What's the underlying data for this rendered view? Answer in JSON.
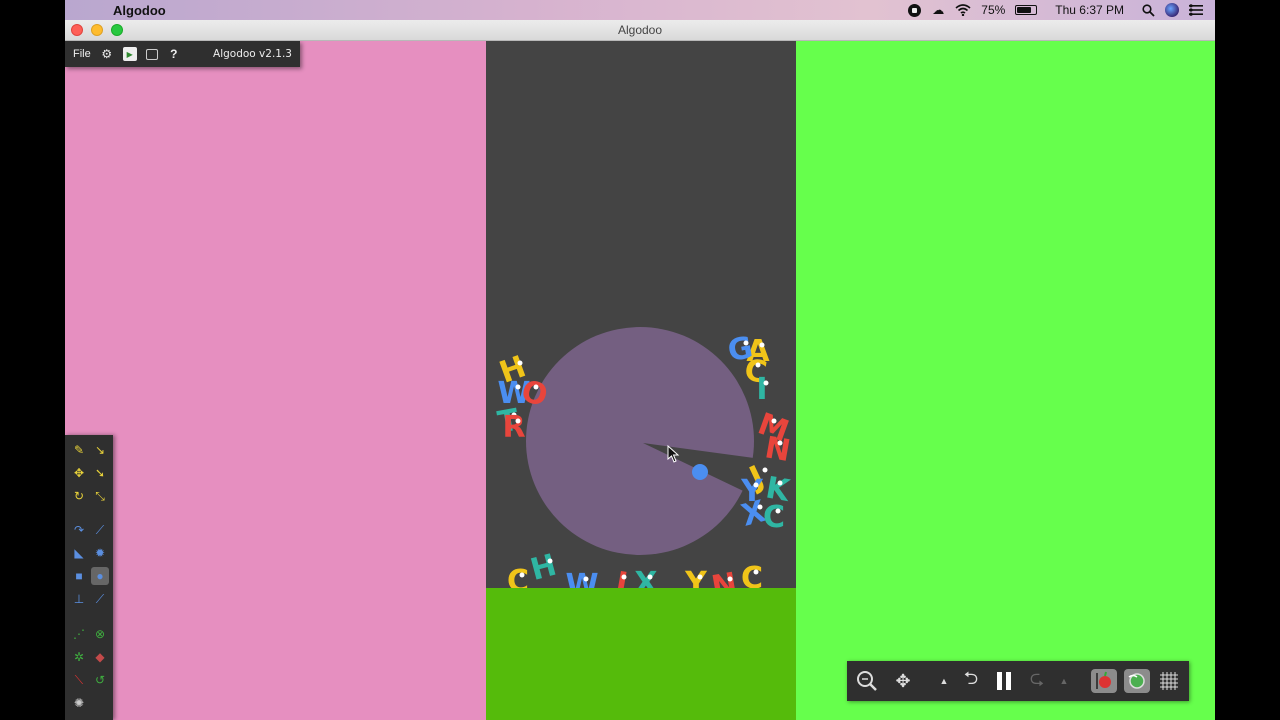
{
  "menubar": {
    "app_name": "Algodoo",
    "battery": "75%",
    "battery_level": 0.75,
    "clock": "Thu 6:37 PM"
  },
  "window": {
    "title": "Algodoo"
  },
  "topbar": {
    "file_label": "File",
    "version": "Algodoo v2.1.3"
  },
  "scene_colors": {
    "left_panel": "#e68fc0",
    "container": "#444444",
    "floor": "#55bb0b",
    "right_panel": "#66ff4c",
    "disk": "#745f81",
    "ball": "#4b8ef0"
  },
  "letters": [
    "A",
    "G",
    "H",
    "W",
    "C",
    "I",
    "O",
    "T",
    "R",
    "M",
    "N",
    "J",
    "Y",
    "K",
    "X",
    "C"
  ]
}
